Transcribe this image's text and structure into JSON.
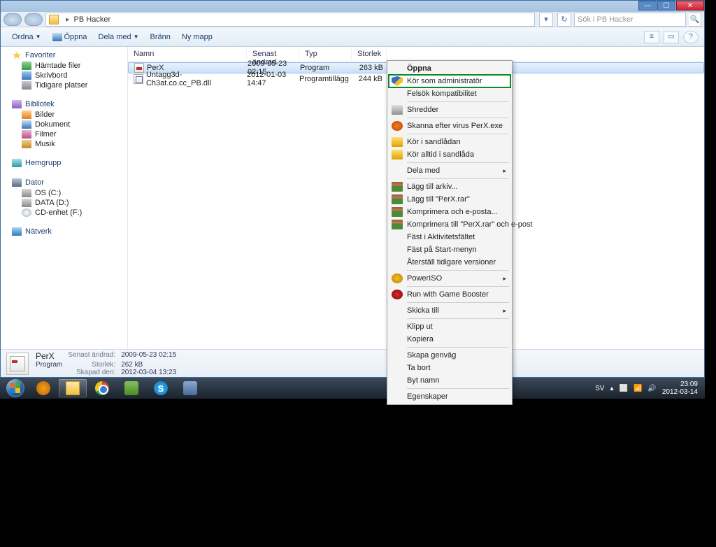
{
  "titlebar": {
    "min": "—",
    "max": "☐",
    "close": "✕"
  },
  "address": {
    "path_sep": "▸",
    "folder": "PB Hacker",
    "refresh": "↻",
    "down": "▾",
    "search_placeholder": "Sök i PB Hacker",
    "glass": "🔍"
  },
  "toolbar": {
    "organize": "Ordna",
    "open": "Öppna",
    "share": "Dela med",
    "burn": "Bränn",
    "new_folder": "Ny mapp",
    "chev": "▼",
    "view": "≡",
    "preview": "▭",
    "help": "?"
  },
  "nav": {
    "favorites": "Favoriter",
    "downloads": "Hämtade filer",
    "desktop": "Skrivbord",
    "recent": "Tidigare platser",
    "libraries": "Bibliotek",
    "pictures": "Bilder",
    "documents": "Dokument",
    "videos": "Filmer",
    "music": "Musik",
    "homegroup": "Hemgrupp",
    "computer": "Dator",
    "drive_c": "OS (C:)",
    "drive_d": "DATA (D:)",
    "drive_cd": "CD-enhet (F:)",
    "network": "Nätverk"
  },
  "columns": {
    "name": "Namn",
    "date": "Senast ändrad",
    "type": "Typ",
    "size": "Storlek"
  },
  "files": [
    {
      "name": "PerX",
      "date": "2009-05-23 02:15",
      "type": "Program",
      "size": "263 kB"
    },
    {
      "name": "Untagg3d-Ch3at.co.cc_PB.dll",
      "date": "2012-01-03 14:47",
      "type": "Programtillägg",
      "size": "244 kB"
    }
  ],
  "details": {
    "name": "PerX",
    "modified_k": "Senast ändrad:",
    "modified_v": "2009-05-23 02:15",
    "type": "Program",
    "size_k": "Storlek:",
    "size_v": "262 kB",
    "created_k": "Skapad den:",
    "created_v": "2012-03-04 13:23"
  },
  "context": {
    "open": "Öppna",
    "run_admin": "Kör som administratör",
    "troubleshoot": "Felsök kompatibilitet",
    "shredder": "Shredder",
    "scan": "Skanna efter virus PerX.exe",
    "sandbox_run": "Kör i sandlådan",
    "sandbox_always": "Kör alltid i sandlåda",
    "share": "Dela med",
    "rar_add_archive": "Lägg till arkiv...",
    "rar_add_perx": "Lägg till \"PerX.rar\"",
    "rar_email": "Komprimera och e-posta...",
    "rar_email_perx": "Komprimera till \"PerX.rar\" och e-post",
    "pin_activity": "Fäst i Aktivitetsfältet",
    "pin_start": "Fäst på Start-menyn",
    "restore": "Återställ tidigare versioner",
    "poweriso": "PowerISO",
    "gamebooster": "Run with Game Booster",
    "sendto": "Skicka till",
    "cut": "Klipp ut",
    "copy": "Kopiera",
    "shortcut": "Skapa genväg",
    "delete": "Ta bort",
    "rename": "Byt namn",
    "properties": "Egenskaper",
    "arrow": "▸"
  },
  "tray": {
    "lang": "SV",
    "up": "▴",
    "net": "⬜",
    "sig": "📶",
    "vol": "🔊",
    "time": "23:09",
    "date": "2012-03-14"
  },
  "skype": "S"
}
